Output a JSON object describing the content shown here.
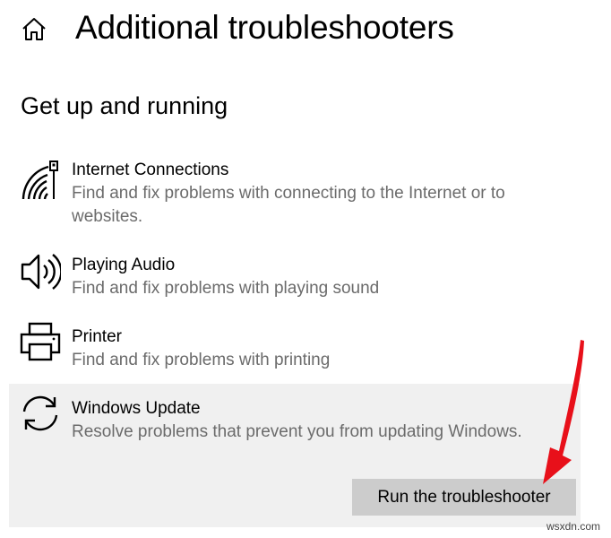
{
  "header": {
    "title": "Additional troubleshooters",
    "home_icon": "home-icon"
  },
  "section": {
    "title": "Get up and running"
  },
  "items": [
    {
      "name": "Internet Connections",
      "description": "Find and fix problems with connecting to the Internet or to websites.",
      "icon": "wifi-signal-icon"
    },
    {
      "name": "Playing Audio",
      "description": "Find and fix problems with playing sound",
      "icon": "speaker-icon"
    },
    {
      "name": "Printer",
      "description": "Find and fix problems with printing",
      "icon": "printer-icon"
    },
    {
      "name": "Windows Update",
      "description": "Resolve problems that prevent you from updating Windows.",
      "icon": "sync-icon",
      "selected": true,
      "button_label": "Run the troubleshooter"
    }
  ],
  "annotation": {
    "arrow_color": "#e8101a"
  },
  "watermark": "wsxdn.com",
  "colors": {
    "background": "#ffffff",
    "secondary_text": "#6b6b6b",
    "selected_background": "#f0f0f0",
    "button_background": "#cccccc"
  }
}
